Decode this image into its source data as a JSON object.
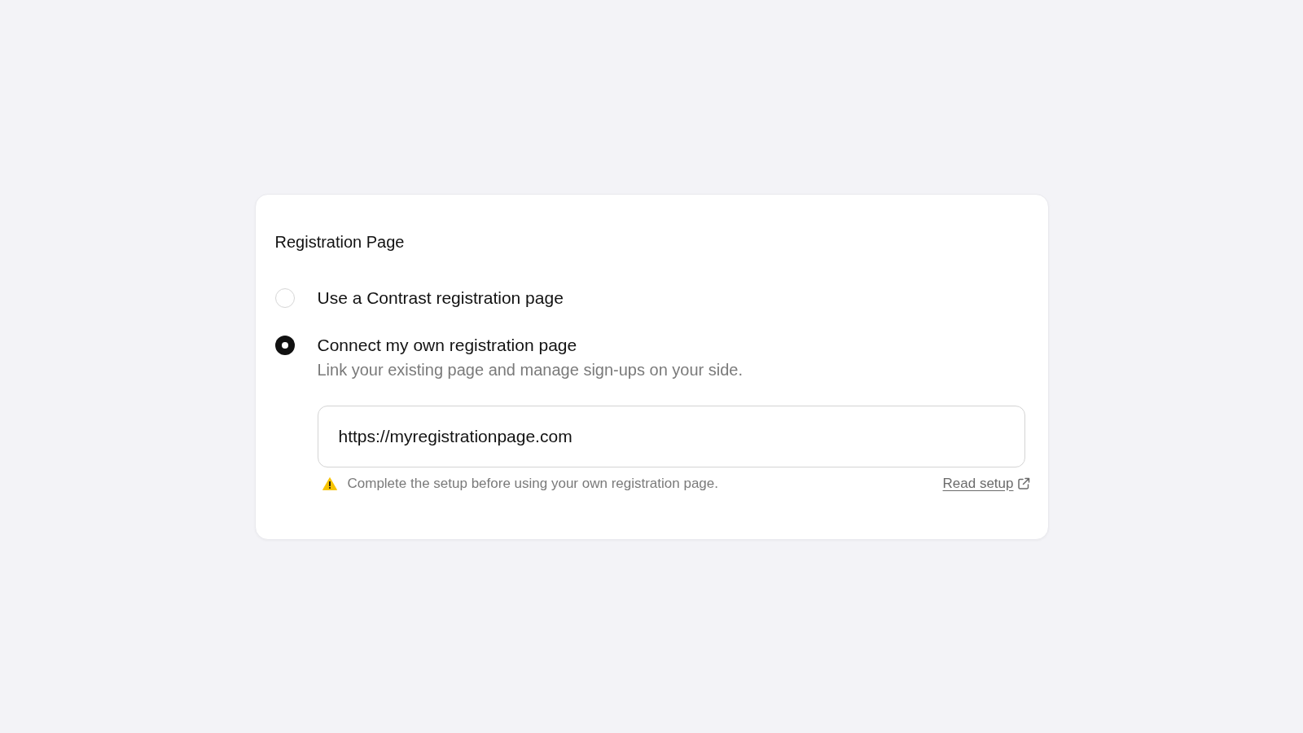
{
  "card": {
    "title": "Registration Page",
    "options": [
      {
        "label": "Use a Contrast registration page",
        "selected": false
      },
      {
        "label": "Connect my own registration page",
        "selected": true,
        "description": "Link your existing page and manage sign-ups on your side.",
        "url_field": {
          "value": "https://myregistrationpage.com"
        },
        "warning": {
          "text": "Complete the setup before using your own registration page.",
          "link": "Read setup"
        }
      }
    ]
  }
}
